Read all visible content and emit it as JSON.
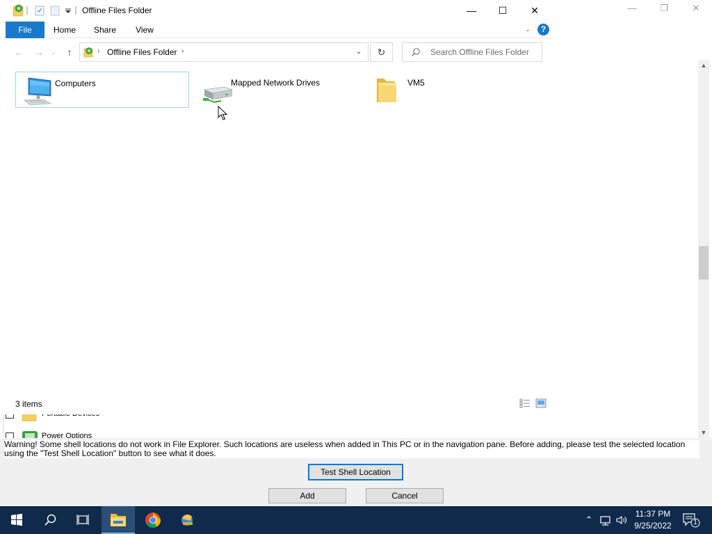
{
  "explorer": {
    "title": "Offline Files Folder",
    "tabs": [
      "File",
      "Home",
      "Share",
      "View"
    ],
    "address": "Offline Files Folder",
    "search_placeholder": "Search Offline Files Folder",
    "help_label": "?",
    "items": [
      {
        "label": "Computers",
        "icon": "computer-icon",
        "selected": true
      },
      {
        "label": "Mapped Network Drives",
        "icon": "network-drive-icon",
        "selected": false
      },
      {
        "label": "VM5",
        "icon": "folder-icon",
        "selected": false
      }
    ],
    "status": "3 items"
  },
  "background_dialog": {
    "list_rows": [
      {
        "label": "Portable Devices",
        "checked": false,
        "icon": "portable-devices-icon"
      },
      {
        "label": "Power Options",
        "checked": false,
        "icon": "power-options-icon"
      }
    ],
    "warning": "Warning! Some shell locations do not work in File Explorer. Such locations are useless when added in This PC or in the navigation pane. Before adding, please test the selected location using the \"Test Shell Location\" button to see what it does.",
    "test_button": "Test Shell Location",
    "add_button": "Add",
    "cancel_button": "Cancel"
  },
  "taskbar": {
    "apps": [
      "start-icon",
      "search-icon",
      "task-view-icon",
      "file-explorer-icon",
      "chrome-icon",
      "app-icon"
    ],
    "active_app": "file-explorer-icon",
    "time": "11:37 PM",
    "date": "9/25/2022",
    "notification_count": "1"
  },
  "colors": {
    "accent": "#1979ca",
    "taskbar": "#0f2a4a",
    "selection_border": "#99d1ff"
  }
}
